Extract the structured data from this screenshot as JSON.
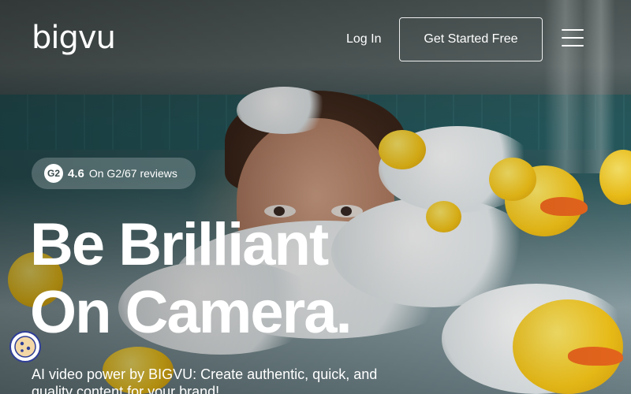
{
  "brand": {
    "logo_text": "bigvu"
  },
  "nav": {
    "login_label": "Log In",
    "cta_label": "Get Started Free",
    "menu_icon": "hamburger-menu-icon"
  },
  "rating": {
    "score": "4.6",
    "text": "On G2/67 reviews",
    "icon": "g2-logo-icon"
  },
  "hero": {
    "headline_line1": "Be Brilliant",
    "headline_line2": "On Camera.",
    "subtitle": "AI video power by BIGVU: Create authentic, quick, and quality content for your brand!"
  },
  "cookie": {
    "icon": "cookie-icon"
  },
  "colors": {
    "text": "#ffffff",
    "cookie_border": "#2f3e98",
    "duck_yellow": "#f5c518",
    "duck_beak": "#f06a1e"
  }
}
